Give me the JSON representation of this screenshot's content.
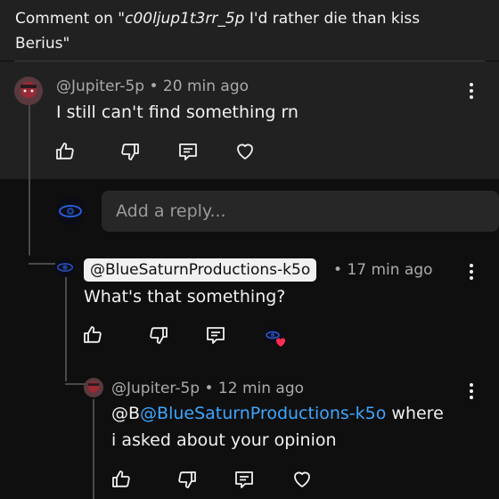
{
  "header": {
    "title_prefix": "Comment on \"",
    "title_handle": "c00ljup1t3rr_5p",
    "title_suffix": " I'd rather die than kiss Berius\""
  },
  "comment": {
    "author": "@Jupiter-5p",
    "separator": "•",
    "time": "20 min ago",
    "text": "I still can't  find something rn"
  },
  "reply_box": {
    "placeholder": "Add a reply..."
  },
  "reply1": {
    "author": "@BlueSaturnProductions-k5o",
    "separator": "•",
    "time": "17 min ago",
    "text": "What's that something?"
  },
  "reply2": {
    "author": "@Jupiter-5p",
    "separator": "•",
    "time": "12 min ago",
    "text_prefix": "@B",
    "mention": "@BlueSaturnProductions-k5o",
    "text_suffix": " where",
    "text_line2": "i asked about your opinion"
  },
  "icons": {
    "like": "thumbs-up-icon",
    "dislike": "thumbs-down-icon",
    "reply": "reply-comment-icon",
    "heart": "heart-icon",
    "more": "more-vertical-icon"
  },
  "colors": {
    "background": "#0f0f0f",
    "panel": "#212121",
    "text": "#f1f1f1",
    "meta": "#aaaaaa",
    "mention": "#3ea6ff",
    "heart": "#ff2d55"
  }
}
